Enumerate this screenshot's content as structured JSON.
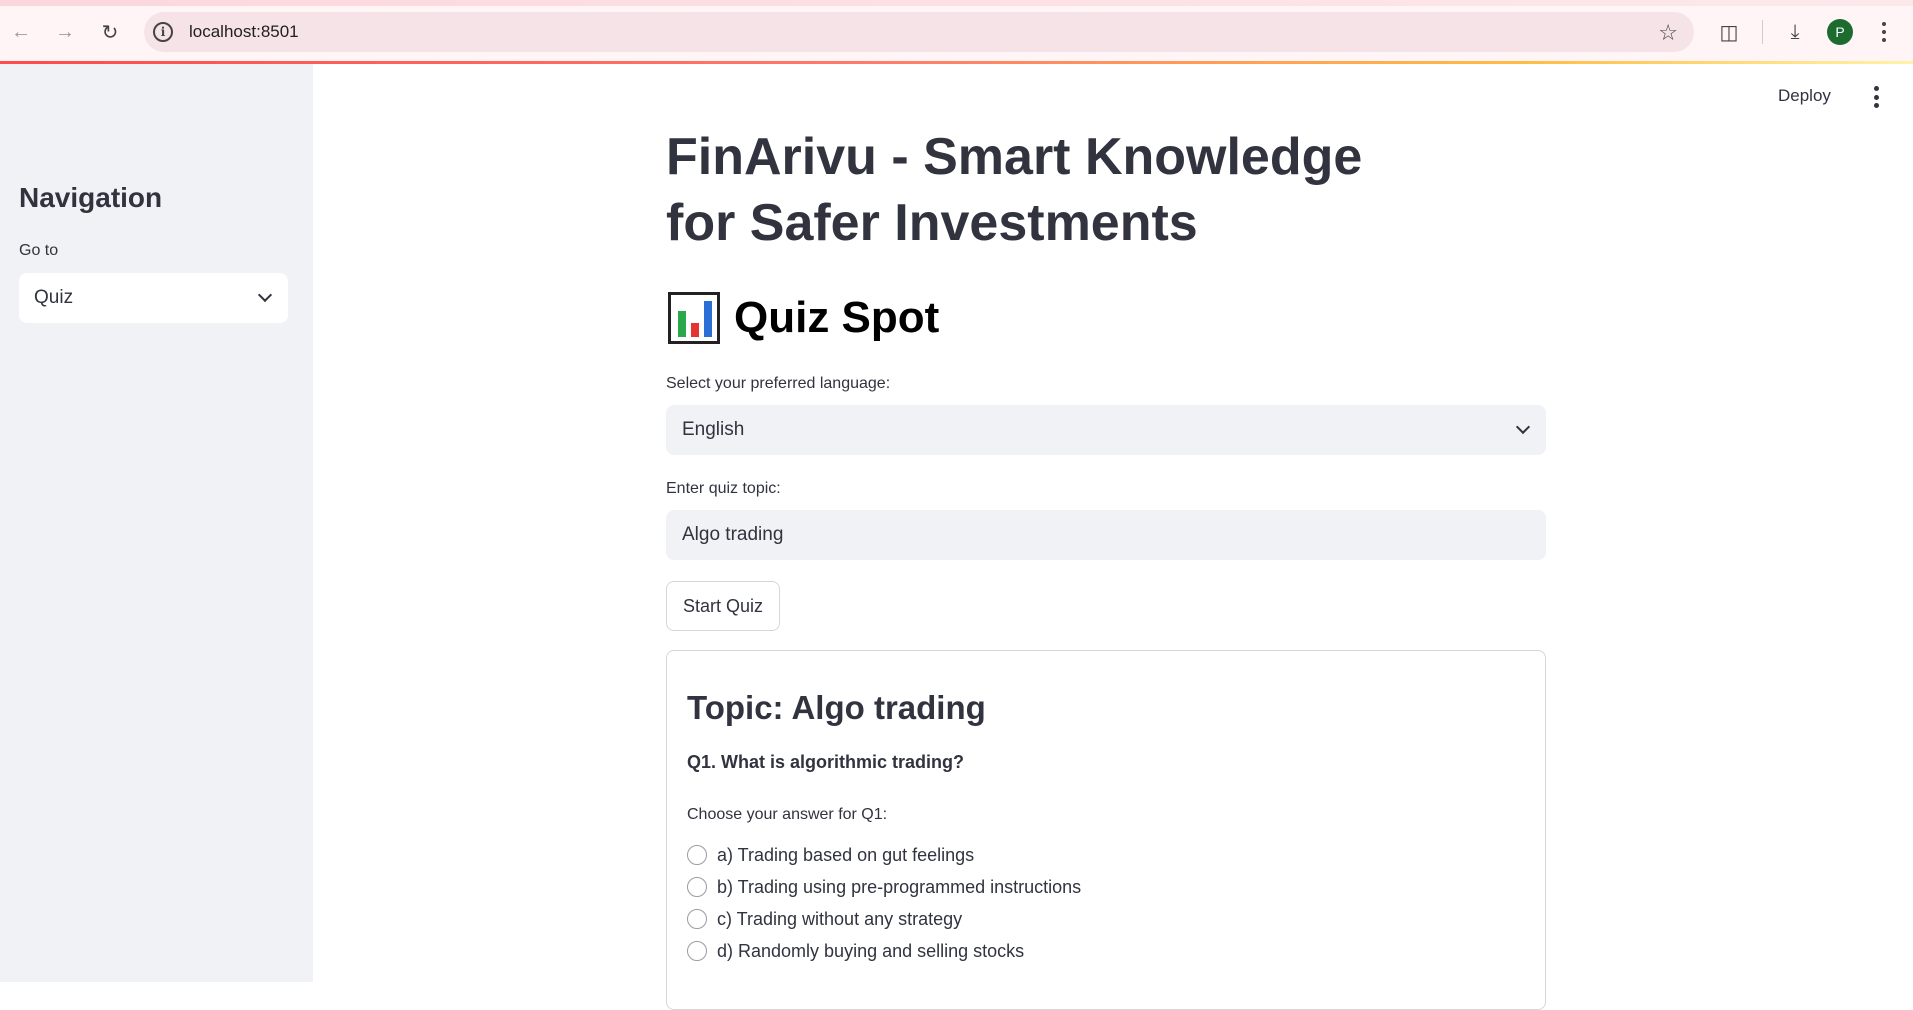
{
  "browser": {
    "url": "localhost:8501",
    "avatar_letter": "P",
    "icons": [
      "back-arrow-icon",
      "forward-arrow-icon",
      "reload-icon",
      "site-info-icon",
      "bookmark-star-icon",
      "extensions-icon",
      "download-icon",
      "chrome-menu-icon"
    ]
  },
  "app_header": {
    "deploy_label": "Deploy"
  },
  "sidebar": {
    "title": "Navigation",
    "select_label": "Go to",
    "selected_page": "Quiz"
  },
  "main": {
    "title": "FinArivu - Smart Knowledge for Safer Investments",
    "quiz_heading": "Quiz Spot",
    "heading_icon": "bar-chart-emoji-icon",
    "language_label": "Select your preferred language:",
    "language_value": "English",
    "topic_label": "Enter quiz topic:",
    "topic_value": "Algo trading",
    "start_button": "Start Quiz"
  },
  "quiz": {
    "topic_title": "Topic: Algo trading",
    "question": "Q1. What is algorithmic trading?",
    "answer_label": "Choose your answer for Q1:",
    "options": [
      "a) Trading based on gut feelings",
      "b) Trading using pre-programmed instructions",
      "c) Trading without any strategy",
      "d) Randomly buying and selling stocks"
    ]
  },
  "colors": {
    "sidebar_bg": "#f0f2f6",
    "text": "#31333f",
    "accent": "#ff4b4b",
    "avatar": "#1e6b2f"
  }
}
